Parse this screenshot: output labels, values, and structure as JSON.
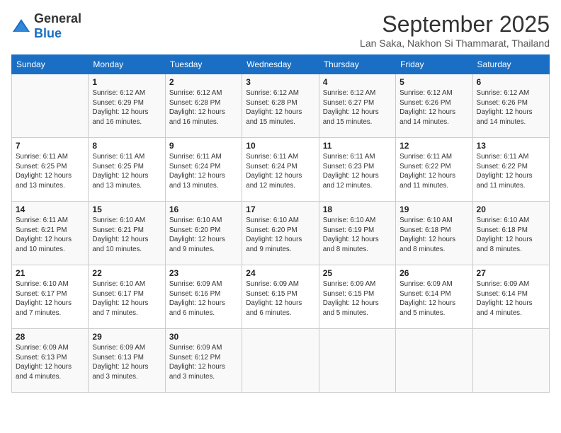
{
  "logo": {
    "general": "General",
    "blue": "Blue"
  },
  "header": {
    "month_year": "September 2025",
    "location": "Lan Saka, Nakhon Si Thammarat, Thailand"
  },
  "weekdays": [
    "Sunday",
    "Monday",
    "Tuesday",
    "Wednesday",
    "Thursday",
    "Friday",
    "Saturday"
  ],
  "weeks": [
    [
      {
        "day": "",
        "sunrise": "",
        "sunset": "",
        "daylight": ""
      },
      {
        "day": "1",
        "sunrise": "Sunrise: 6:12 AM",
        "sunset": "Sunset: 6:29 PM",
        "daylight": "Daylight: 12 hours and 16 minutes."
      },
      {
        "day": "2",
        "sunrise": "Sunrise: 6:12 AM",
        "sunset": "Sunset: 6:28 PM",
        "daylight": "Daylight: 12 hours and 16 minutes."
      },
      {
        "day": "3",
        "sunrise": "Sunrise: 6:12 AM",
        "sunset": "Sunset: 6:28 PM",
        "daylight": "Daylight: 12 hours and 15 minutes."
      },
      {
        "day": "4",
        "sunrise": "Sunrise: 6:12 AM",
        "sunset": "Sunset: 6:27 PM",
        "daylight": "Daylight: 12 hours and 15 minutes."
      },
      {
        "day": "5",
        "sunrise": "Sunrise: 6:12 AM",
        "sunset": "Sunset: 6:26 PM",
        "daylight": "Daylight: 12 hours and 14 minutes."
      },
      {
        "day": "6",
        "sunrise": "Sunrise: 6:12 AM",
        "sunset": "Sunset: 6:26 PM",
        "daylight": "Daylight: 12 hours and 14 minutes."
      }
    ],
    [
      {
        "day": "7",
        "sunrise": "Sunrise: 6:11 AM",
        "sunset": "Sunset: 6:25 PM",
        "daylight": "Daylight: 12 hours and 13 minutes."
      },
      {
        "day": "8",
        "sunrise": "Sunrise: 6:11 AM",
        "sunset": "Sunset: 6:25 PM",
        "daylight": "Daylight: 12 hours and 13 minutes."
      },
      {
        "day": "9",
        "sunrise": "Sunrise: 6:11 AM",
        "sunset": "Sunset: 6:24 PM",
        "daylight": "Daylight: 12 hours and 13 minutes."
      },
      {
        "day": "10",
        "sunrise": "Sunrise: 6:11 AM",
        "sunset": "Sunset: 6:24 PM",
        "daylight": "Daylight: 12 hours and 12 minutes."
      },
      {
        "day": "11",
        "sunrise": "Sunrise: 6:11 AM",
        "sunset": "Sunset: 6:23 PM",
        "daylight": "Daylight: 12 hours and 12 minutes."
      },
      {
        "day": "12",
        "sunrise": "Sunrise: 6:11 AM",
        "sunset": "Sunset: 6:22 PM",
        "daylight": "Daylight: 12 hours and 11 minutes."
      },
      {
        "day": "13",
        "sunrise": "Sunrise: 6:11 AM",
        "sunset": "Sunset: 6:22 PM",
        "daylight": "Daylight: 12 hours and 11 minutes."
      }
    ],
    [
      {
        "day": "14",
        "sunrise": "Sunrise: 6:11 AM",
        "sunset": "Sunset: 6:21 PM",
        "daylight": "Daylight: 12 hours and 10 minutes."
      },
      {
        "day": "15",
        "sunrise": "Sunrise: 6:10 AM",
        "sunset": "Sunset: 6:21 PM",
        "daylight": "Daylight: 12 hours and 10 minutes."
      },
      {
        "day": "16",
        "sunrise": "Sunrise: 6:10 AM",
        "sunset": "Sunset: 6:20 PM",
        "daylight": "Daylight: 12 hours and 9 minutes."
      },
      {
        "day": "17",
        "sunrise": "Sunrise: 6:10 AM",
        "sunset": "Sunset: 6:20 PM",
        "daylight": "Daylight: 12 hours and 9 minutes."
      },
      {
        "day": "18",
        "sunrise": "Sunrise: 6:10 AM",
        "sunset": "Sunset: 6:19 PM",
        "daylight": "Daylight: 12 hours and 8 minutes."
      },
      {
        "day": "19",
        "sunrise": "Sunrise: 6:10 AM",
        "sunset": "Sunset: 6:18 PM",
        "daylight": "Daylight: 12 hours and 8 minutes."
      },
      {
        "day": "20",
        "sunrise": "Sunrise: 6:10 AM",
        "sunset": "Sunset: 6:18 PM",
        "daylight": "Daylight: 12 hours and 8 minutes."
      }
    ],
    [
      {
        "day": "21",
        "sunrise": "Sunrise: 6:10 AM",
        "sunset": "Sunset: 6:17 PM",
        "daylight": "Daylight: 12 hours and 7 minutes."
      },
      {
        "day": "22",
        "sunrise": "Sunrise: 6:10 AM",
        "sunset": "Sunset: 6:17 PM",
        "daylight": "Daylight: 12 hours and 7 minutes."
      },
      {
        "day": "23",
        "sunrise": "Sunrise: 6:09 AM",
        "sunset": "Sunset: 6:16 PM",
        "daylight": "Daylight: 12 hours and 6 minutes."
      },
      {
        "day": "24",
        "sunrise": "Sunrise: 6:09 AM",
        "sunset": "Sunset: 6:15 PM",
        "daylight": "Daylight: 12 hours and 6 minutes."
      },
      {
        "day": "25",
        "sunrise": "Sunrise: 6:09 AM",
        "sunset": "Sunset: 6:15 PM",
        "daylight": "Daylight: 12 hours and 5 minutes."
      },
      {
        "day": "26",
        "sunrise": "Sunrise: 6:09 AM",
        "sunset": "Sunset: 6:14 PM",
        "daylight": "Daylight: 12 hours and 5 minutes."
      },
      {
        "day": "27",
        "sunrise": "Sunrise: 6:09 AM",
        "sunset": "Sunset: 6:14 PM",
        "daylight": "Daylight: 12 hours and 4 minutes."
      }
    ],
    [
      {
        "day": "28",
        "sunrise": "Sunrise: 6:09 AM",
        "sunset": "Sunset: 6:13 PM",
        "daylight": "Daylight: 12 hours and 4 minutes."
      },
      {
        "day": "29",
        "sunrise": "Sunrise: 6:09 AM",
        "sunset": "Sunset: 6:13 PM",
        "daylight": "Daylight: 12 hours and 3 minutes."
      },
      {
        "day": "30",
        "sunrise": "Sunrise: 6:09 AM",
        "sunset": "Sunset: 6:12 PM",
        "daylight": "Daylight: 12 hours and 3 minutes."
      },
      {
        "day": "",
        "sunrise": "",
        "sunset": "",
        "daylight": ""
      },
      {
        "day": "",
        "sunrise": "",
        "sunset": "",
        "daylight": ""
      },
      {
        "day": "",
        "sunrise": "",
        "sunset": "",
        "daylight": ""
      },
      {
        "day": "",
        "sunrise": "",
        "sunset": "",
        "daylight": ""
      }
    ]
  ]
}
